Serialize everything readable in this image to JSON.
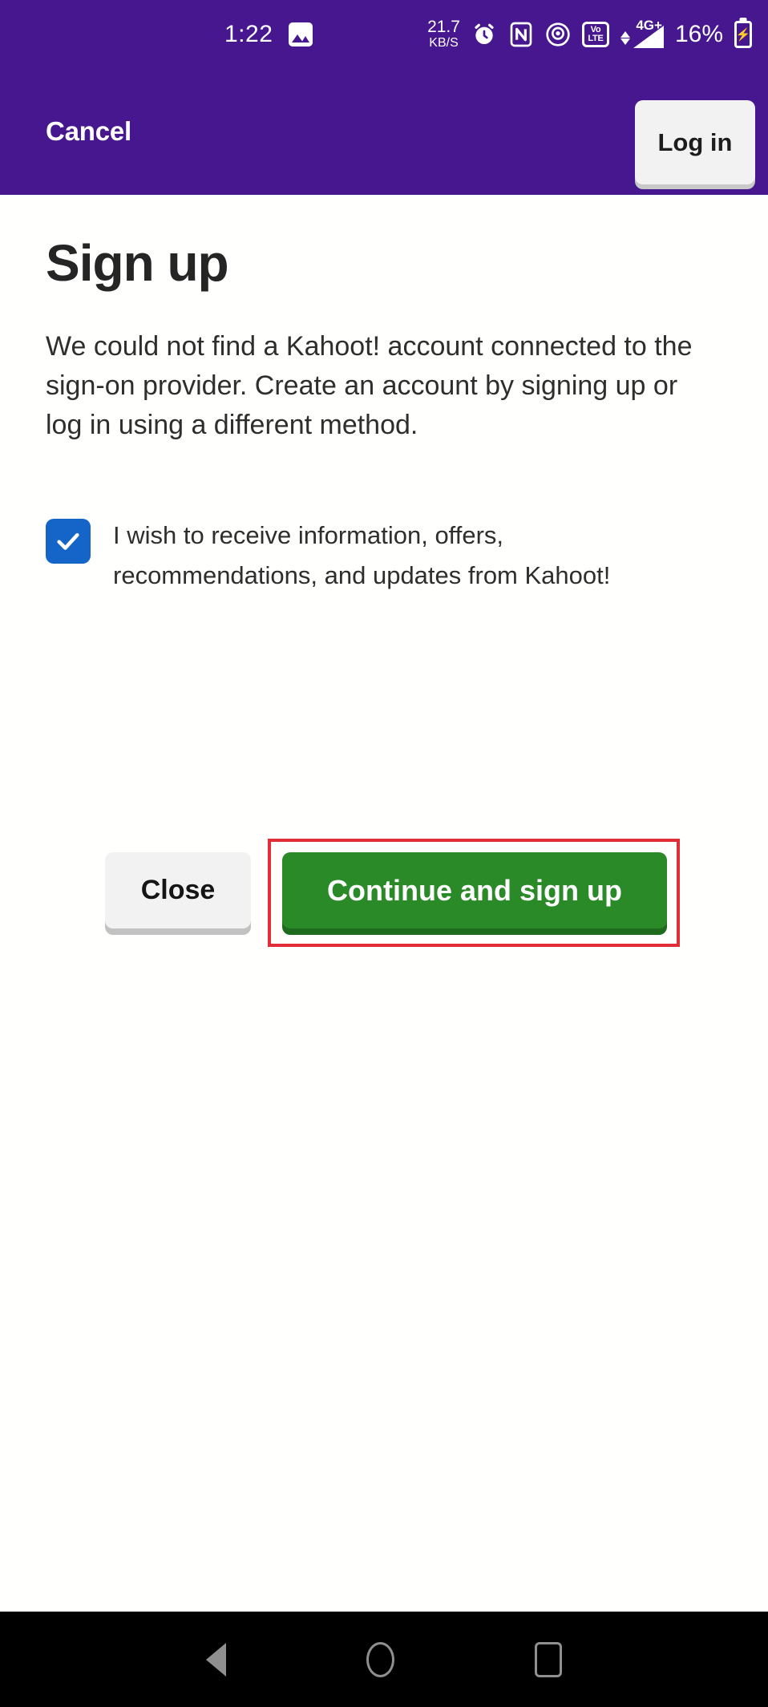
{
  "colors": {
    "brand_purple": "#46178F",
    "accent_green": "#2a8a28",
    "checkbox_blue": "#1565c8",
    "highlight_red": "#e02d38",
    "button_gray": "#f2f2f2",
    "navbar_black": "#000000"
  },
  "statusbar": {
    "time": "1:22",
    "photo_icon": "image-icon",
    "network_speed_value": "21.7",
    "network_speed_unit": "KB/S",
    "alarm_icon": "alarm-clock-icon",
    "nfc_icon": "nfc-icon",
    "hotspot_icon": "hotspot-icon",
    "volte_top": "VoLTE",
    "volte_line1": "Vo",
    "volte_line2": "LTE",
    "signal_label": "4G+",
    "battery_percent": "16%",
    "battery_icon": "battery-charging-icon"
  },
  "appbar": {
    "cancel_label": "Cancel",
    "login_label": "Log in"
  },
  "main": {
    "title": "Sign up",
    "body": "We could not find a Kahoot! account connected to the sign-on provider. Create an account by signing up or log in using a different method.",
    "consent": {
      "checked": true,
      "label": "I wish to receive information, offers, recommendations, and updates from Kahoot!"
    },
    "actions": {
      "close_label": "Close",
      "signup_label": "Continue and sign up",
      "highlighted": "Continue and sign up"
    }
  },
  "navbar": {
    "back_icon": "back-triangle-icon",
    "home_icon": "home-circle-icon",
    "recents_icon": "recents-square-icon"
  }
}
